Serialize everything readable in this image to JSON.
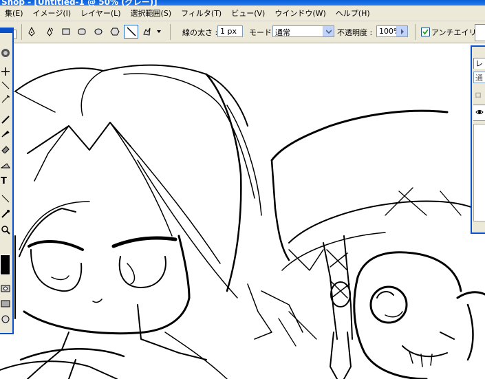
{
  "window": {
    "title": "Shop - [Untitled-1 @ 50% (グレー)]"
  },
  "menu": [
    "集(E)",
    "イメージ(I)",
    "レイヤー(L)",
    "選択範囲(S)",
    "フィルタ(T)",
    "ビュー(V)",
    "ウインドウ(W)",
    "ヘルプ(H)"
  ],
  "options": {
    "stroke_label": "線の太さ :",
    "stroke_value": "1 px",
    "mode_label": "モード :",
    "mode_value": "通常",
    "opacity_label": "不透明度 :",
    "opacity_value": "100%",
    "antialias_label": "アンチエイリアス",
    "antialias_checked": true
  },
  "layers_panel": {
    "tab": "レ",
    "mode_fragment": "通",
    "lock_fragment": "ロ"
  },
  "colors": {
    "ui_bg": "#ece9d8",
    "accent": "#0a50c8",
    "selection": "#316ac5"
  }
}
